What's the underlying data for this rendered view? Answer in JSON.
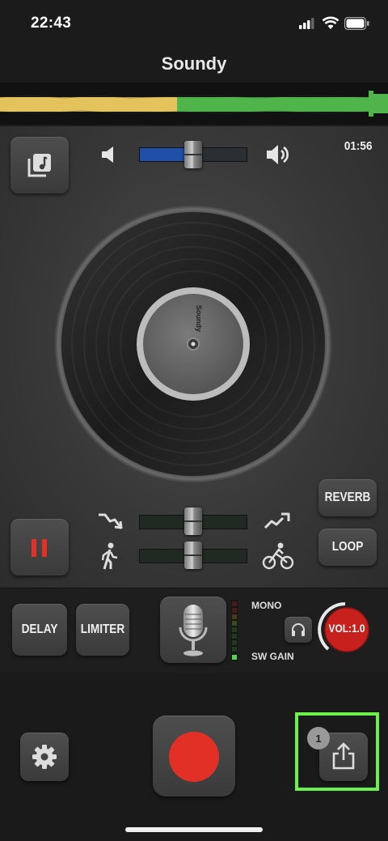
{
  "status_bar": {
    "time": "22:43"
  },
  "nav": {
    "title": "Soundy"
  },
  "player": {
    "elapsed": "01:56",
    "record_label": "Soundy"
  },
  "effects": {
    "reverb_label": "REVERB",
    "loop_label": "LOOP",
    "delay_label": "DELAY",
    "limiter_label": "LIMITER"
  },
  "mic": {
    "mono_label": "MONO",
    "sw_gain_label": "SW GAIN",
    "volume_label": "VOL:1.0"
  },
  "share": {
    "badge_count": "1"
  },
  "sliders": {
    "volume_level": 0.5,
    "speed_level": 0.5,
    "tempo_level": 0.5
  },
  "colors": {
    "accent_red": "#e33027",
    "wave_yellow": "#e4c25c",
    "wave_green": "#4fb54a",
    "volume_fill": "#1f4fa8",
    "highlight_frame": "#6cf04a"
  },
  "icons": [
    "music-library-icon",
    "volume-low-icon",
    "volume-high-icon",
    "pause-icon",
    "slow-down-icon",
    "speed-up-icon",
    "walking-icon",
    "cycling-icon",
    "microphone-icon",
    "headphones-icon",
    "settings-icon",
    "record-icon",
    "share-icon"
  ]
}
